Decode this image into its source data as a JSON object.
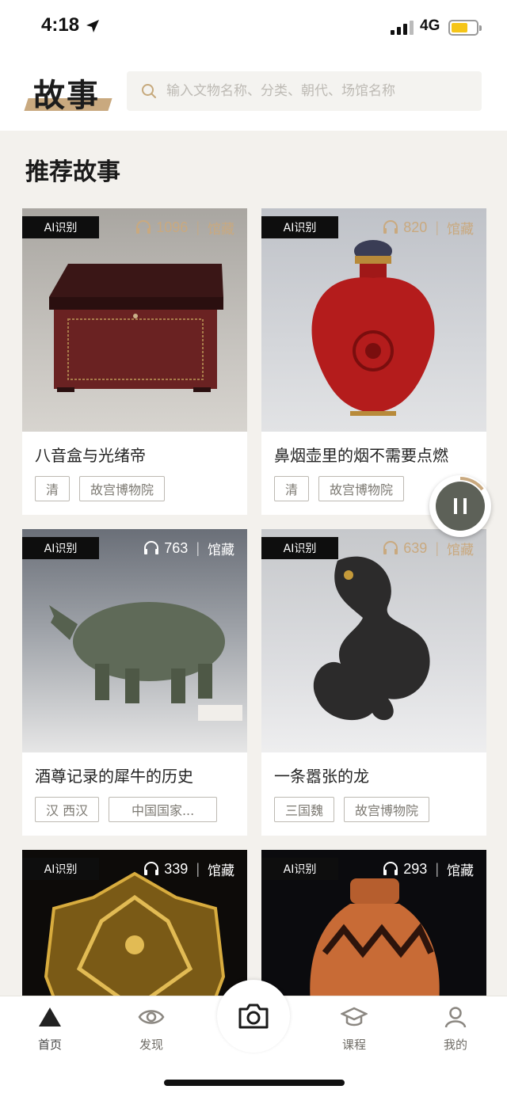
{
  "status_bar": {
    "time": "4:18",
    "network": "4G"
  },
  "header": {
    "title": "故事",
    "search_placeholder": "输入文物名称、分类、朝代、场馆名称"
  },
  "section": {
    "title": "推荐故事"
  },
  "cards": [
    {
      "badge": "AI识别",
      "plays": "1096",
      "collect": "馆藏",
      "title": "八音盒与光绪帝",
      "tags": [
        "清",
        "故宫博物院"
      ]
    },
    {
      "badge": "AI识别",
      "plays": "820",
      "collect": "馆藏",
      "title": "鼻烟壶里的烟不需要点燃",
      "tags": [
        "清",
        "故宫博物院"
      ]
    },
    {
      "badge": "AI识别",
      "plays": "763",
      "collect": "馆藏",
      "title": "酒尊记录的犀牛的历史",
      "tags": [
        "汉 西汉",
        "中国国家..."
      ]
    },
    {
      "badge": "AI识别",
      "plays": "639",
      "collect": "馆藏",
      "title": "一条嚣张的龙",
      "tags": [
        "三国魏",
        "故宫博物院"
      ]
    },
    {
      "badge": "AI识别",
      "plays": "339",
      "collect": "馆藏",
      "title": "",
      "tags": []
    },
    {
      "badge": "AI识别",
      "plays": "293",
      "collect": "馆藏",
      "title": "",
      "tags": []
    }
  ],
  "bottom_nav": {
    "items": [
      {
        "label": "首页",
        "icon": "home-icon"
      },
      {
        "label": "发现",
        "icon": "eye-icon"
      },
      {
        "label": "课程",
        "icon": "graduation-cap-icon"
      },
      {
        "label": "我的",
        "icon": "user-icon"
      }
    ],
    "center": {
      "icon": "camera-icon"
    }
  },
  "colors": {
    "accent": "#c9a97f",
    "background": "#f3f1ed",
    "badge": "#0e0e0e"
  }
}
